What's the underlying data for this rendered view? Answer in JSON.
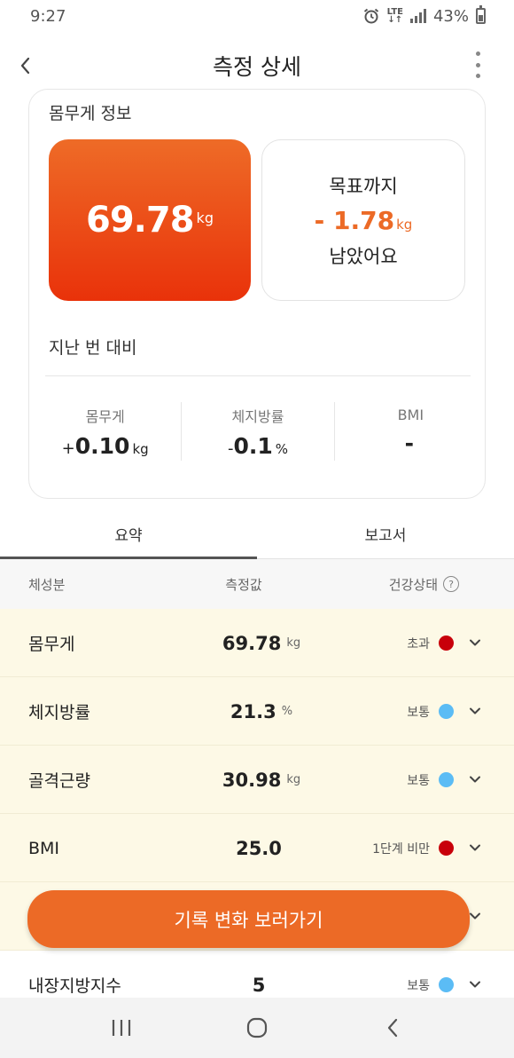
{
  "status_bar": {
    "time": "9:27",
    "network": "LTE",
    "battery": "43%"
  },
  "header": {
    "title": "측정 상세"
  },
  "weight_card": {
    "section_title": "몸무게 정보",
    "weight_value": "69.78",
    "weight_unit": "kg",
    "goal_line1": "목표까지",
    "goal_value": "- 1.78",
    "goal_unit": "kg",
    "goal_line3": "남았어요",
    "compare_title": "지난 번 대비",
    "compare": [
      {
        "label": "몸무게",
        "sign": "+",
        "value": "0.10",
        "unit": "kg"
      },
      {
        "label": "체지방률",
        "sign": "-",
        "value": "0.1",
        "unit": "%"
      },
      {
        "label": "BMI",
        "sign": "",
        "value": "-",
        "unit": ""
      }
    ]
  },
  "tabs": [
    {
      "label": "요약"
    },
    {
      "label": "보고서"
    }
  ],
  "table": {
    "headers": {
      "name": "체성분",
      "value": "측정값",
      "status": "건강상태"
    },
    "rows": [
      {
        "name": "몸무게",
        "value": "69.78",
        "unit": "kg",
        "status": "초과",
        "dot_color": "#c8000a"
      },
      {
        "name": "체지방률",
        "value": "21.3",
        "unit": "%",
        "status": "보통",
        "dot_color": "#5bbcf5"
      },
      {
        "name": "골격근량",
        "value": "30.98",
        "unit": "kg",
        "status": "보통",
        "dot_color": "#5bbcf5"
      },
      {
        "name": "BMI",
        "value": "25.0",
        "unit": "",
        "status": "1단계 비만",
        "dot_color": "#c8000a"
      },
      {
        "name": "",
        "value": "",
        "unit": "",
        "status": "",
        "dot_color": ""
      },
      {
        "name": "내장지방지수",
        "value": "5",
        "unit": "",
        "status": "보통",
        "dot_color": "#5bbcf5"
      }
    ]
  },
  "cta": {
    "label": "기록 변화 보러가기"
  },
  "colors": {
    "accent": "#ec6a26",
    "weight_gradient_top": "#ee6b27",
    "weight_gradient_bottom": "#e9320a",
    "row_bg": "#fdf9e6"
  }
}
